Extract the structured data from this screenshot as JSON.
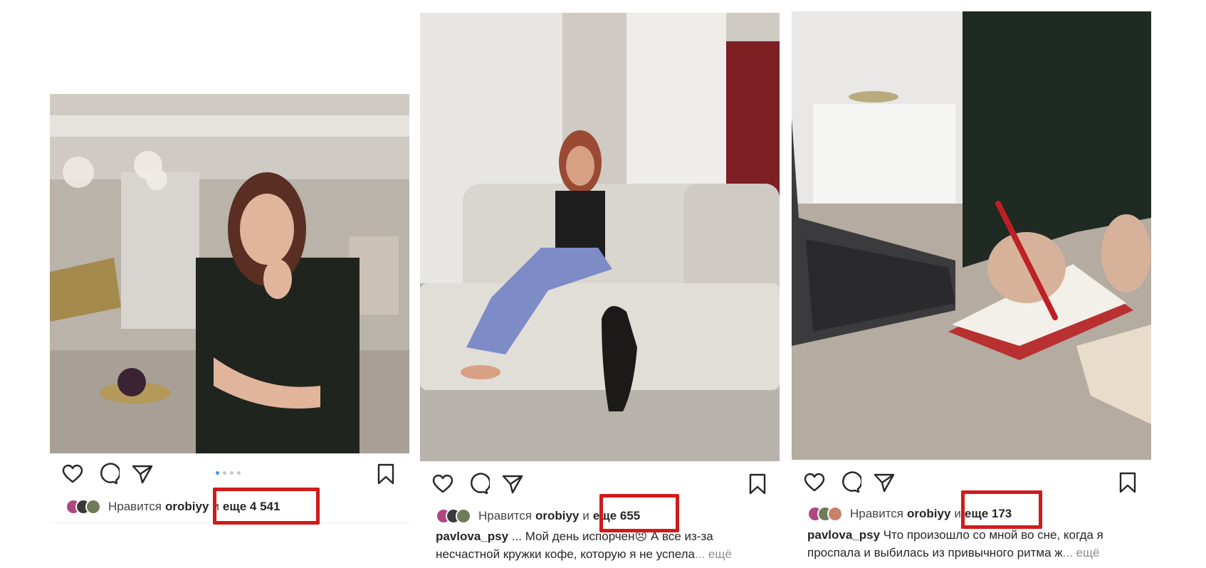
{
  "posts": [
    {
      "likers_prefix": "Нравится",
      "liker": "orobiyy",
      "and": "и",
      "more_likes": "еще 4 541",
      "has_carousel_dots": true
    },
    {
      "likers_prefix": "Нравится",
      "liker": "orobiyy",
      "and": "и",
      "more_likes": "еще 655",
      "caption_user": "pavlova_psy",
      "caption_line1": "... Мой день испорчен😣 А все из-за",
      "caption_line2": "несчастной кружки кофе, которую я не успела",
      "caption_more": "... ещё"
    },
    {
      "likers_prefix": "Нравится",
      "liker": "orobiyy",
      "and": "и",
      "more_likes": "еще 173",
      "caption_user": "pavlova_psy",
      "caption_line1": "Что произошло со мной во сне, когда я",
      "caption_line2": "проспала и выбилась из привычного ритма ж",
      "caption_more": "... ещё"
    }
  ],
  "colors": {
    "highlight": "#d11b1b",
    "carousel_active": "#3897f0"
  },
  "icons": [
    "heart-icon",
    "comment-icon",
    "share-icon",
    "bookmark-icon"
  ]
}
